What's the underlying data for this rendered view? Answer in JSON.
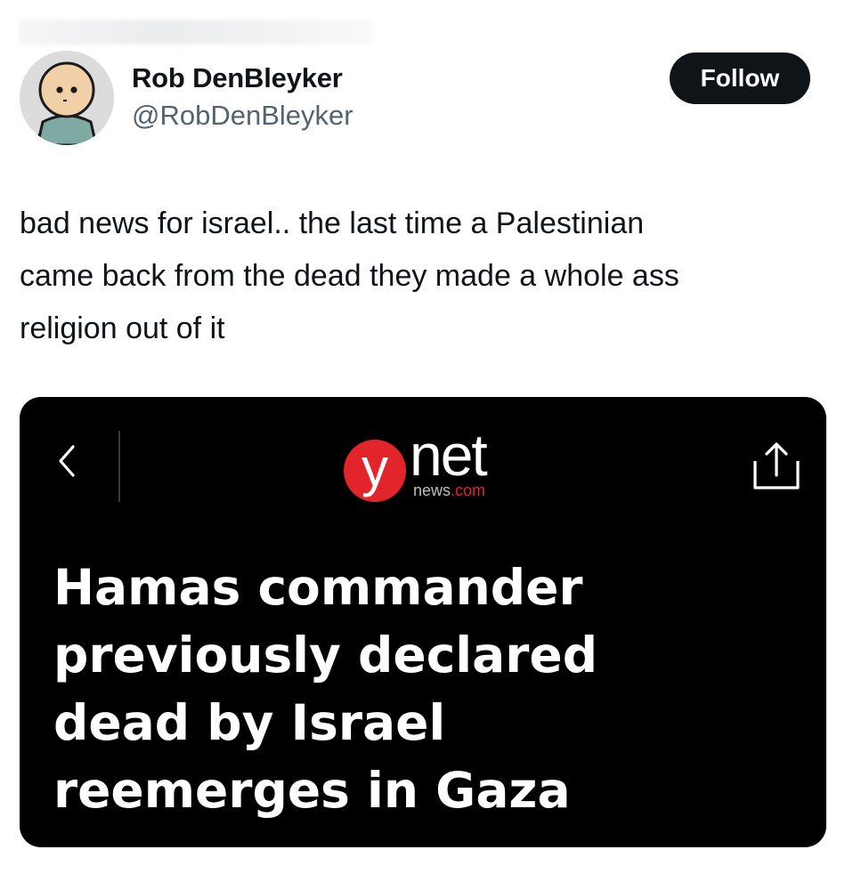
{
  "author": {
    "display_name": "Rob DenBleyker",
    "handle": "@RobDenBleyker",
    "avatar_icon": "cartoon-character-avatar"
  },
  "actions": {
    "follow_label": "Follow"
  },
  "tweet": {
    "text_lines": [
      "bad news for israel.. the last time a Palestinian",
      "came back from the dead they made a whole ass",
      "religion out of it"
    ]
  },
  "media": {
    "logo": {
      "brand_letter": "y",
      "brand_word": "net",
      "domain_name": "news",
      "domain_tld": ".com"
    },
    "headline_lines": [
      "Hamas commander",
      "previously declared",
      "dead by Israel",
      "reemerges in Gaza"
    ],
    "icons": {
      "back": "chevron-left-icon",
      "share": "share-icon"
    }
  },
  "colors": {
    "follow_bg": "#0f1419",
    "handle": "#536471",
    "ynet_red": "#e2252b",
    "card_bg": "#000000"
  }
}
